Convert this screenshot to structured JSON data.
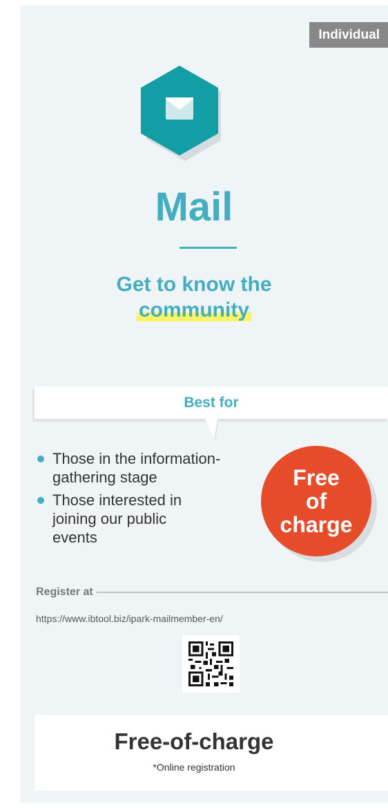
{
  "badge": "Individual",
  "icon": "envelope-hexagon-icon",
  "title": "Mail",
  "subtitle": {
    "line1": "Get to know the",
    "line2": "community"
  },
  "best_for": {
    "heading": "Best for",
    "items": [
      "Those in the information-\ngathering stage",
      "Those interested in\njoining our public\nevents"
    ]
  },
  "price_circle": {
    "line1": "Free",
    "line2": "of",
    "line3": "charge"
  },
  "register": {
    "label": "Register at",
    "url": "https://www.ibtool.biz/ipark-mailmember-en/"
  },
  "qr_icon": "qr-code-icon",
  "footer": {
    "title": "Free-of-charge",
    "note": "*Online registration"
  },
  "colors": {
    "accent": "#44aec0",
    "price": "#e64b2a",
    "badge": "#888888",
    "highlight": "#fff366",
    "background": "#eff4f7"
  }
}
